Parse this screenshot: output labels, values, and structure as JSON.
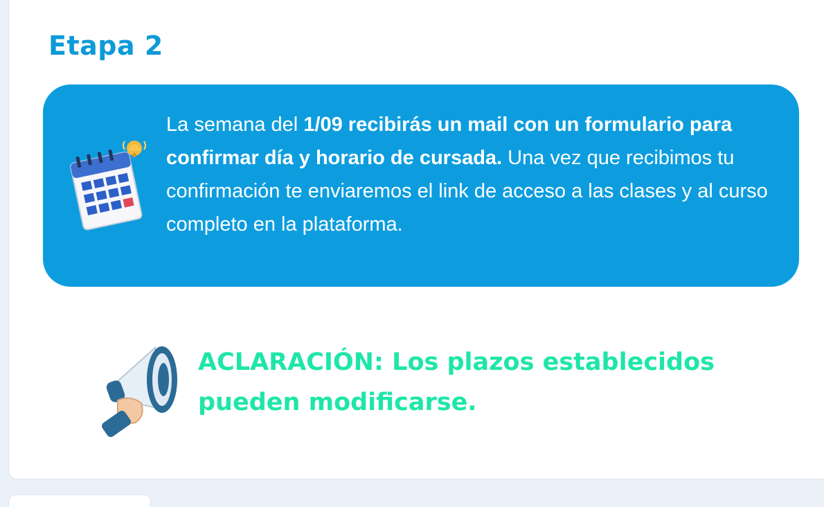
{
  "stage": {
    "title": "Etapa 2"
  },
  "info": {
    "part1": "La semana del ",
    "bold1": "1/09 recibirás un mail con un formulario para confirmar día y horario de cursada.",
    "part2": " Una vez que recibimos tu confirmación te enviaremos el link de acceso a las clases y al curso completo en la plataforma.",
    "icon": "calendar-bell-icon"
  },
  "note": {
    "text": "ACLARACIÓN: Los plazos establecidos pueden modificarse.",
    "icon": "megaphone-icon"
  },
  "colors": {
    "title": "#0d9ad8",
    "info_bg": "#0d9ddf",
    "note_text": "#1fe6a8",
    "page_bg": "#eaf1f8"
  }
}
